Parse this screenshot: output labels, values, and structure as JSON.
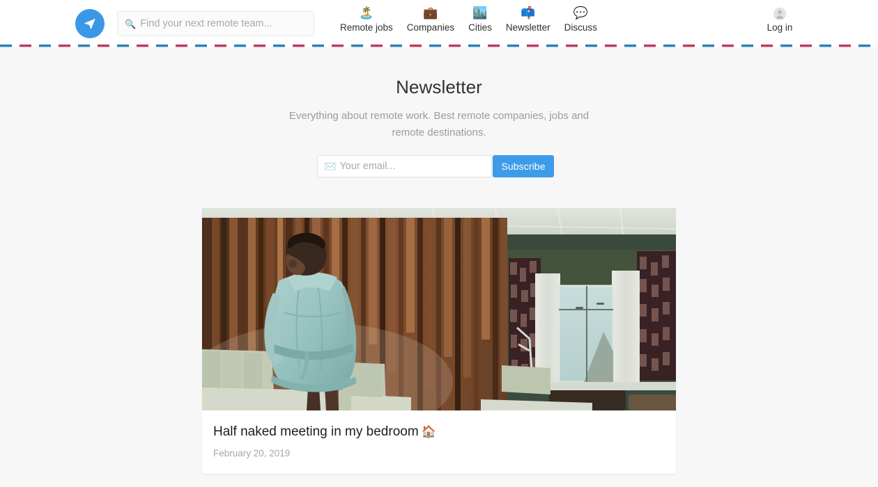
{
  "brand": {
    "logo_icon": "paper-plane-icon",
    "logo_color": "#3b97e8"
  },
  "search": {
    "icon": "search-icon",
    "placeholder": "Find your next remote team...",
    "value": ""
  },
  "nav": {
    "items": [
      {
        "label": "Remote jobs",
        "emoji": "🏝️",
        "icon": "desert-island-icon"
      },
      {
        "label": "Companies",
        "emoji": "💼",
        "icon": "briefcase-icon"
      },
      {
        "label": "Cities",
        "emoji": "🏙️",
        "icon": "cityscape-icon"
      },
      {
        "label": "Newsletter",
        "emoji": "📫",
        "icon": "mailbox-icon"
      },
      {
        "label": "Discuss",
        "emoji": "💬",
        "icon": "speech-balloon-icon"
      }
    ]
  },
  "account": {
    "label": "Log in",
    "icon": "avatar-icon"
  },
  "page": {
    "title": "Newsletter",
    "subtitle": "Everything about remote work. Best remote companies, jobs and remote destinations."
  },
  "subscribe": {
    "email_emoji": "✉️",
    "email_icon": "envelope-icon",
    "placeholder": "Your email...",
    "value": "",
    "button_label": "Subscribe",
    "button_color": "#3d9bea"
  },
  "article": {
    "title": "Half naked meeting in my bedroom",
    "title_emoji": "🏠",
    "title_emoji_icon": "house-icon",
    "date": "February 20, 2019",
    "thumb_alt": "Man in a light blue bathrobe standing in a room with a wood slat wall and a curtained window"
  },
  "colors": {
    "page_background": "#f7f7f7",
    "header_background": "#ffffff",
    "stripe_blue": "#2c7fb8",
    "stripe_red": "#c0395e",
    "accent": "#3d9bea"
  }
}
